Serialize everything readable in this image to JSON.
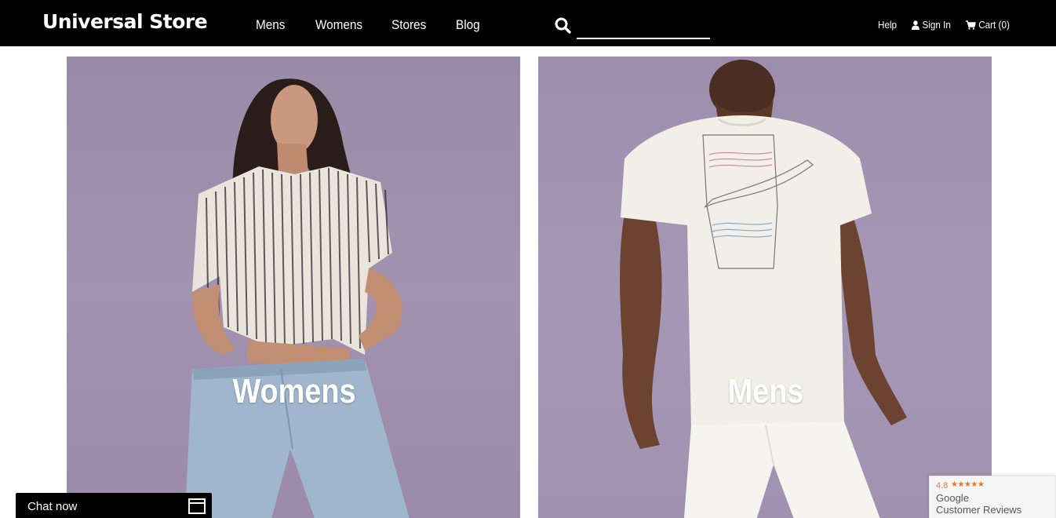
{
  "header": {
    "logo": "Universal Store",
    "nav": [
      "Mens",
      "Womens",
      "Stores",
      "Blog"
    ],
    "search": {
      "value": "",
      "placeholder": ""
    },
    "utility": {
      "help": "Help",
      "sign_in": "Sign In",
      "cart": "Cart (0)"
    },
    "icons": {
      "search": "search-icon",
      "user": "user-icon",
      "cart": "cart-icon"
    }
  },
  "hero": {
    "tiles": [
      {
        "label": "Womens",
        "image": "woman in striped shirt and jeans"
      },
      {
        "label": "Mens",
        "image": "man in white graphic t-shirt"
      }
    ],
    "background_color": "#a394b1"
  },
  "chat": {
    "label": "Chat now",
    "icon": "window-icon"
  },
  "reviews": {
    "rating": "4.8",
    "stars": "★★★★★",
    "line1": "Google",
    "line2": "Customer Reviews",
    "star_color": "#e5792e"
  }
}
